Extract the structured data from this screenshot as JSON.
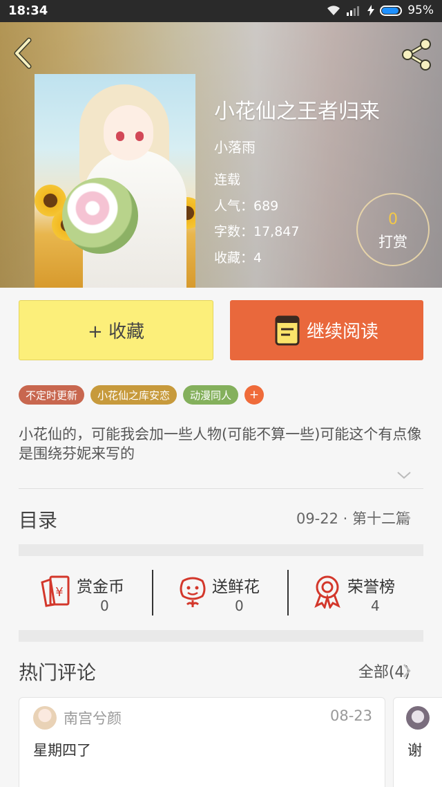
{
  "status_bar": {
    "time": "18:34",
    "battery": "95%"
  },
  "book": {
    "title": "小花仙之王者归来",
    "author": "小落雨",
    "status": "连载",
    "popularity": "人气：689",
    "word_count": "字数：17,847",
    "favorites": "收藏：4"
  },
  "tip": {
    "count": "0",
    "label": "打赏"
  },
  "actions": {
    "favorite": "+ 收藏",
    "continue_reading": "继续阅读"
  },
  "tags": [
    {
      "label": "不定时更新",
      "color": "#c8674f"
    },
    {
      "label": "小花仙之库安恋",
      "color": "#c79a3c"
    },
    {
      "label": "动漫同人",
      "color": "#84b05c"
    }
  ],
  "tag_add": "+",
  "description": "小花仙的，可能我会加一些人物(可能不算一些)可能这个有点像是围绕芬妮来写的",
  "toc": {
    "label": "目录",
    "latest": "09-22 · 第十二篇"
  },
  "stats": [
    {
      "label": "赏金币",
      "value": "0",
      "icon": "red-envelope-yen-icon"
    },
    {
      "label": "送鲜花",
      "value": "0",
      "icon": "flower-icon"
    },
    {
      "label": "荣誉榜",
      "value": "4",
      "icon": "medal-icon"
    }
  ],
  "comments_section": {
    "label": "热门评论",
    "all": "全部(4)"
  },
  "comments": [
    {
      "user": "南宫兮颜",
      "date": "08-23",
      "text": "星期四了"
    },
    {
      "user": "",
      "date": "",
      "text": "谢"
    }
  ],
  "colors": {
    "accent_orange": "#e9683c",
    "fav_yellow": "#fcef7a",
    "stat_red": "#d3372b"
  }
}
